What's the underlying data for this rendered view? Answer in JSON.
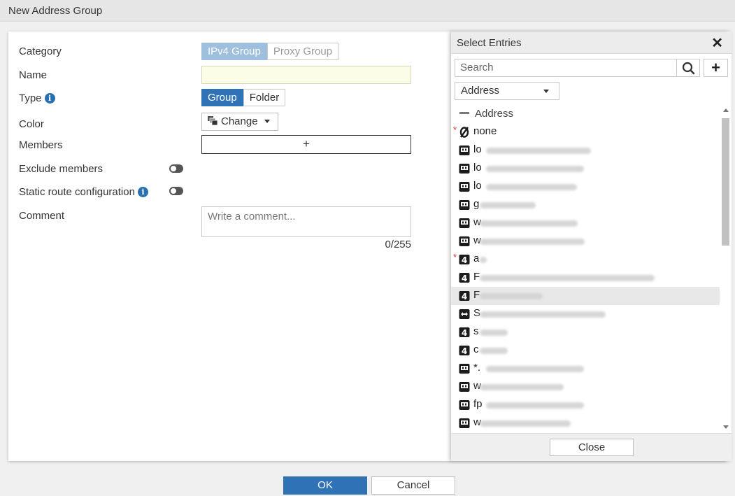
{
  "window": {
    "title": "New Address Group"
  },
  "form": {
    "category_label": "Category",
    "category_options": [
      "IPv4 Group",
      "Proxy Group"
    ],
    "name_label": "Name",
    "name_value": "",
    "type_label": "Type",
    "type_options": [
      "Group",
      "Folder"
    ],
    "color_label": "Color",
    "color_button": "Change",
    "members_label": "Members",
    "members_add": "+",
    "exclude_label": "Exclude members",
    "static_route_label": "Static route configuration",
    "comment_label": "Comment",
    "comment_placeholder": "Write a comment...",
    "comment_counter": "0/255"
  },
  "select_entries": {
    "title": "Select Entries",
    "search_placeholder": "Search",
    "filter_selected": "Address",
    "group_header": "Address",
    "entries": [
      {
        "text": "none",
        "icon": "any-address-icon",
        "starred": true
      },
      {
        "text": "lo",
        "icon": "fqdn-address-icon",
        "starred": false
      },
      {
        "text": "lo",
        "icon": "fqdn-address-icon",
        "starred": false
      },
      {
        "text": "lo",
        "icon": "fqdn-address-icon",
        "starred": false
      },
      {
        "text": "g",
        "icon": "fqdn-address-icon",
        "starred": false
      },
      {
        "text": "w",
        "icon": "fqdn-address-icon",
        "starred": false
      },
      {
        "text": "w",
        "icon": "fqdn-address-icon",
        "starred": false
      },
      {
        "text": "a",
        "icon": "ipv4-address-icon",
        "starred": true
      },
      {
        "text": "F",
        "icon": "ipv4-address-icon",
        "starred": false
      },
      {
        "text": "F",
        "icon": "ipv4-address-icon",
        "starred": false
      },
      {
        "text": "S",
        "icon": "range-address-icon",
        "starred": false
      },
      {
        "text": "s",
        "icon": "ipv4-address-icon",
        "starred": false
      },
      {
        "text": "c",
        "icon": "ipv4-address-icon",
        "starred": false
      },
      {
        "text": "*.",
        "icon": "fqdn-address-icon",
        "starred": false
      },
      {
        "text": "w",
        "icon": "fqdn-address-icon",
        "starred": false
      },
      {
        "text": "fp",
        "icon": "fqdn-address-icon",
        "starred": false
      },
      {
        "text": "w",
        "icon": "fqdn-address-icon",
        "starred": false
      }
    ],
    "close_label": "Close"
  },
  "footer": {
    "ok_label": "OK",
    "cancel_label": "Cancel"
  },
  "colors": {
    "primary": "#2f72b5",
    "primary_light": "#9ebfdd",
    "name_field_bg": "#fcfde6",
    "required_star": "#dd3333"
  }
}
